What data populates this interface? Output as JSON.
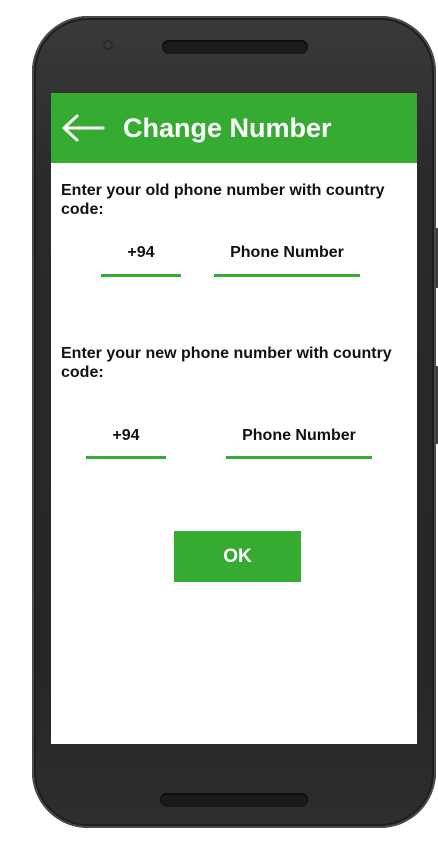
{
  "app_bar": {
    "back_icon": "arrow-left-icon",
    "title": "Change Number"
  },
  "old_number": {
    "instruction": "Enter your old phone number with country code:",
    "country_code": "+94",
    "phone_placeholder": "Phone Number"
  },
  "new_number": {
    "instruction": "Enter your new phone number with country code:",
    "country_code": "+94",
    "phone_placeholder": "Phone Number"
  },
  "ok_button": {
    "label": "OK"
  },
  "colors": {
    "accent": "#36ab32",
    "background": "#ffffff",
    "text": "#111111",
    "device": "#2a2a2a"
  }
}
